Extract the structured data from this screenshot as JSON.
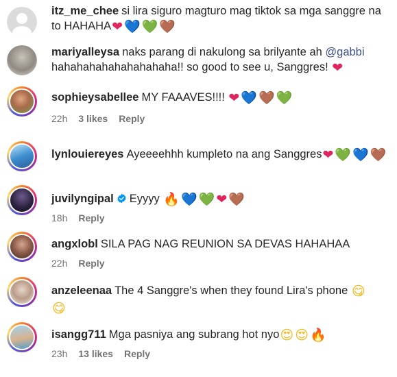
{
  "comments": [
    {
      "username": "itz_me_chee",
      "text": "si lira siguro magturo mag tiktok sa mga sanggre na to HAHAHA",
      "emojis": [
        "❤",
        "💙",
        "💚",
        "🤎"
      ]
    },
    {
      "username": "mariyalleysa",
      "text_before": "naks parang di nakulong sa brilyante ah ",
      "mention": "@gabbi",
      "text_after": " hahahahahahahahahaha!! so good to see u, Sanggres! ",
      "emojis": [
        "❤"
      ]
    },
    {
      "username": "sophieysabellee",
      "text": "MY FAAAVES!!!! ",
      "emojis": [
        "❤",
        "💙",
        "🤎",
        "💚"
      ],
      "time": "22h",
      "likes": "3 likes",
      "reply": "Reply"
    },
    {
      "username": "lynlouiereyes",
      "text": "Ayeeeehhh kumpleto na ang Sanggres",
      "emojis": [
        "❤",
        "💚",
        "💙",
        "🤎"
      ]
    },
    {
      "username": "juvilyngipal",
      "text": "Eyyyy ",
      "emojis": [
        "🔥",
        "💙",
        "💚",
        "❤",
        "🤎"
      ],
      "time": "18h",
      "reply": "Reply"
    },
    {
      "username": "angxlobl",
      "text": "SILA PAG NAG REUNION SA DEVAS HAHAHAA",
      "time": "22h",
      "reply": "Reply"
    },
    {
      "username": "anzeleenaa",
      "text": "The 4 Sanggre's when they found Lira's phone ",
      "emojis": [
        "😋",
        "😋"
      ]
    },
    {
      "username": "isangg711",
      "text": "Mga pasniya ang subrang hot nyo",
      "emojis": [
        "😍",
        "😍",
        "🔥"
      ],
      "time": "23h",
      "likes": "13 likes",
      "reply": "Reply"
    }
  ],
  "colors": {
    "text": "#262626",
    "meta": "#737373",
    "mention": "#385185",
    "verified": "#0095f6"
  }
}
